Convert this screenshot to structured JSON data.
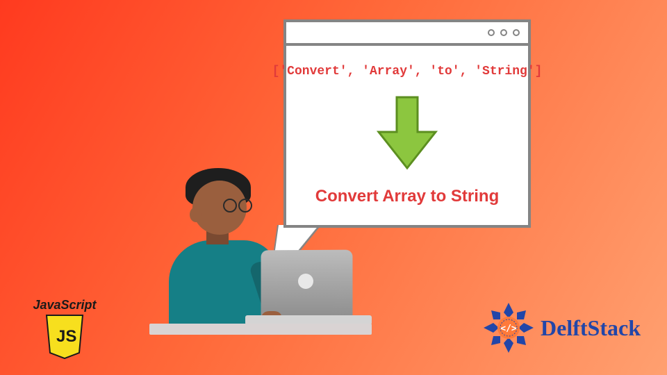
{
  "window": {
    "array_text": "['Convert', 'Array', 'to', 'String']",
    "result_text": "Convert Array to String"
  },
  "js_badge": {
    "label": "JavaScript",
    "shield_text": "JS"
  },
  "brand": {
    "name": "DelftStack",
    "glyph": "</>"
  },
  "colors": {
    "accent_red": "#e13a3a",
    "arrow_green": "#8cc63f",
    "brand_blue": "#2246a8",
    "js_yellow": "#f7df1e"
  }
}
